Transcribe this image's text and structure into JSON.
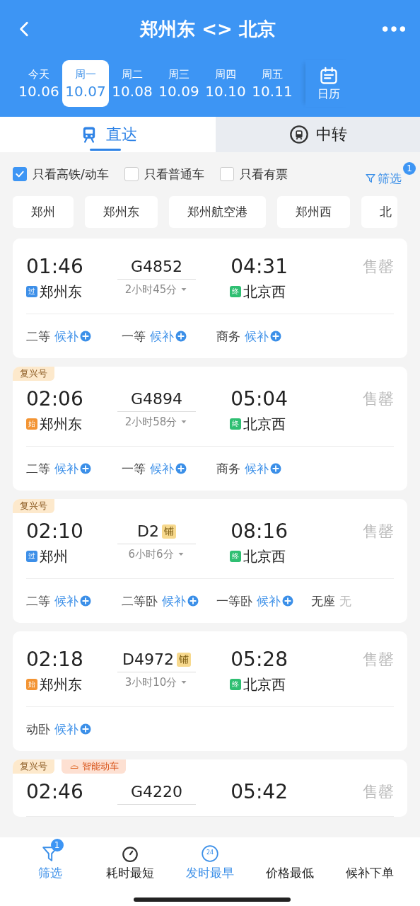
{
  "header": {
    "title": "郑州东 <> 北京"
  },
  "dates": [
    {
      "weekday": "今天",
      "date": "10.06",
      "selected": false
    },
    {
      "weekday": "周一",
      "date": "10.07",
      "selected": true
    },
    {
      "weekday": "周二",
      "date": "10.08",
      "selected": false
    },
    {
      "weekday": "周三",
      "date": "10.09",
      "selected": false
    },
    {
      "weekday": "周四",
      "date": "10.10",
      "selected": false
    },
    {
      "weekday": "周五",
      "date": "10.11",
      "selected": false
    }
  ],
  "calendar": {
    "label": "日历"
  },
  "tabs": [
    {
      "label": "直达",
      "selected": true
    },
    {
      "label": "中转",
      "selected": false
    }
  ],
  "filters": [
    {
      "label": "只看高铁/动车",
      "checked": true
    },
    {
      "label": "只看普通车",
      "checked": false
    },
    {
      "label": "只看有票",
      "checked": false
    }
  ],
  "filter_link": {
    "label": "筛选",
    "badge": "1"
  },
  "stations": [
    "郑州",
    "郑州东",
    "郑州航空港",
    "郑州西",
    "北"
  ],
  "trains": [
    {
      "depart": "01:46",
      "from_mark": {
        "text": "过",
        "kind": "pass"
      },
      "from": "郑州东",
      "number": "G4852",
      "duration": "2小时45分",
      "arrive": "04:31",
      "to_mark": {
        "text": "终",
        "kind": "end"
      },
      "to": "北京西",
      "status": "售罄",
      "seats": [
        {
          "class": "二等",
          "state": "候补",
          "kind": "waitlist"
        },
        {
          "class": "一等",
          "state": "候补",
          "kind": "waitlist"
        },
        {
          "class": "商务",
          "state": "候补",
          "kind": "waitlist"
        }
      ]
    },
    {
      "tags": [
        {
          "text": "复兴号",
          "kind": "fuxing"
        }
      ],
      "depart": "02:06",
      "from_mark": {
        "text": "始",
        "kind": "start"
      },
      "from": "郑州东",
      "number": "G4894",
      "duration": "2小时58分",
      "arrive": "05:04",
      "to_mark": {
        "text": "终",
        "kind": "end"
      },
      "to": "北京西",
      "status": "售罄",
      "seats": [
        {
          "class": "二等",
          "state": "候补",
          "kind": "waitlist"
        },
        {
          "class": "一等",
          "state": "候补",
          "kind": "waitlist"
        },
        {
          "class": "商务",
          "state": "候补",
          "kind": "waitlist"
        }
      ]
    },
    {
      "tags": [
        {
          "text": "复兴号",
          "kind": "fuxing"
        }
      ],
      "depart": "02:10",
      "from_mark": {
        "text": "过",
        "kind": "pass"
      },
      "from": "郑州",
      "number": "D2",
      "berth": "铺",
      "duration": "6小时6分",
      "arrive": "08:16",
      "to_mark": {
        "text": "终",
        "kind": "end"
      },
      "to": "北京西",
      "status": "售罄",
      "seats": [
        {
          "class": "二等",
          "state": "候补",
          "kind": "waitlist"
        },
        {
          "class": "二等卧",
          "state": "候补",
          "kind": "waitlist"
        },
        {
          "class": "一等卧",
          "state": "候补",
          "kind": "waitlist"
        },
        {
          "class": "无座",
          "state": "无",
          "kind": "none"
        }
      ]
    },
    {
      "depart": "02:18",
      "from_mark": {
        "text": "始",
        "kind": "start"
      },
      "from": "郑州东",
      "number": "D4972",
      "berth": "铺",
      "duration": "3小时10分",
      "arrive": "05:28",
      "to_mark": {
        "text": "终",
        "kind": "end"
      },
      "to": "北京西",
      "status": "售罄",
      "seats": [
        {
          "class": "动卧",
          "state": "候补",
          "kind": "waitlist"
        }
      ]
    },
    {
      "tags": [
        {
          "text": "复兴号",
          "kind": "fuxing"
        },
        {
          "text": "智能动车",
          "kind": "smart"
        }
      ],
      "depart": "02:46",
      "number": "G4220",
      "arrive": "05:42",
      "status": "售罄"
    }
  ],
  "bottom_nav": [
    {
      "label": "筛选",
      "badge": "1",
      "selected": true
    },
    {
      "label": "耗时最短",
      "selected": false
    },
    {
      "label": "发时最早",
      "icon_text": "24",
      "selected": true
    },
    {
      "label": "价格最低",
      "selected": false
    },
    {
      "label": "候补下单",
      "selected": false
    }
  ]
}
